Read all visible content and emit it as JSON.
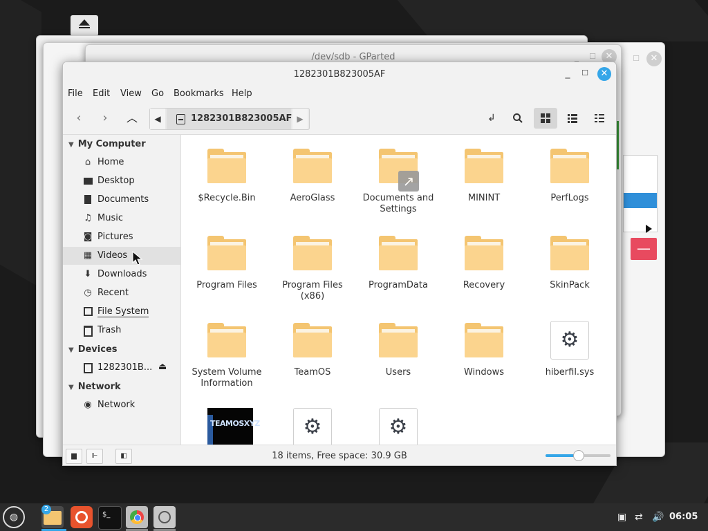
{
  "background_windows": {
    "gparted_title": "/dev/sdb - GParted"
  },
  "window": {
    "title": "1282301B823005AF"
  },
  "menu": [
    "File",
    "Edit",
    "View",
    "Go",
    "Bookmarks",
    "Help"
  ],
  "toolbar": {
    "breadcrumb": "1282301B823005AF"
  },
  "sidebar": {
    "sections": [
      {
        "title": "My Computer",
        "items": [
          {
            "label": "Home",
            "icon": "home-icon"
          },
          {
            "label": "Desktop",
            "icon": "desktop-icon"
          },
          {
            "label": "Documents",
            "icon": "document-icon"
          },
          {
            "label": "Music",
            "icon": "music-icon"
          },
          {
            "label": "Pictures",
            "icon": "camera-icon"
          },
          {
            "label": "Videos",
            "icon": "film-icon",
            "selected": true
          },
          {
            "label": "Downloads",
            "icon": "download-icon"
          },
          {
            "label": "Recent",
            "icon": "clock-icon"
          },
          {
            "label": "File System",
            "icon": "drive-icon"
          },
          {
            "label": "Trash",
            "icon": "trash-icon"
          }
        ]
      },
      {
        "title": "Devices",
        "items": [
          {
            "label": "1282301B...",
            "icon": "drive-icon",
            "eject": true
          }
        ]
      },
      {
        "title": "Network",
        "items": [
          {
            "label": "Network",
            "icon": "globe-icon"
          }
        ]
      }
    ]
  },
  "files": [
    {
      "name": "$Recycle.Bin",
      "kind": "folder"
    },
    {
      "name": "AeroGlass",
      "kind": "folder"
    },
    {
      "name": "Documents and Settings",
      "kind": "folder-link"
    },
    {
      "name": "MININT",
      "kind": "folder"
    },
    {
      "name": "PerfLogs",
      "kind": "folder"
    },
    {
      "name": "Program Files",
      "kind": "folder"
    },
    {
      "name": "Program Files (x86)",
      "kind": "folder"
    },
    {
      "name": "ProgramData",
      "kind": "folder"
    },
    {
      "name": "Recovery",
      "kind": "folder"
    },
    {
      "name": "SkinPack",
      "kind": "folder"
    },
    {
      "name": "System Volume Information",
      "kind": "folder"
    },
    {
      "name": "TeamOS",
      "kind": "folder"
    },
    {
      "name": "Users",
      "kind": "folder"
    },
    {
      "name": "Windows",
      "kind": "folder"
    },
    {
      "name": "hiberfil.sys",
      "kind": "system-file"
    },
    {
      "name": "",
      "kind": "image-thumbnail",
      "thumb_text": "TEAMOSXYZ"
    },
    {
      "name": "",
      "kind": "system-file"
    },
    {
      "name": "",
      "kind": "system-file"
    }
  ],
  "status": {
    "text": "18 items, Free space: 30.9 GB",
    "zoom_fraction": 0.5
  },
  "taskbar": {
    "files_badge": "2",
    "clock": "06:05"
  },
  "colors": {
    "accent": "#35a6e8",
    "folder": "#f4c571",
    "folder_front": "#fbd48e",
    "delete_button": "#e84a5f"
  }
}
